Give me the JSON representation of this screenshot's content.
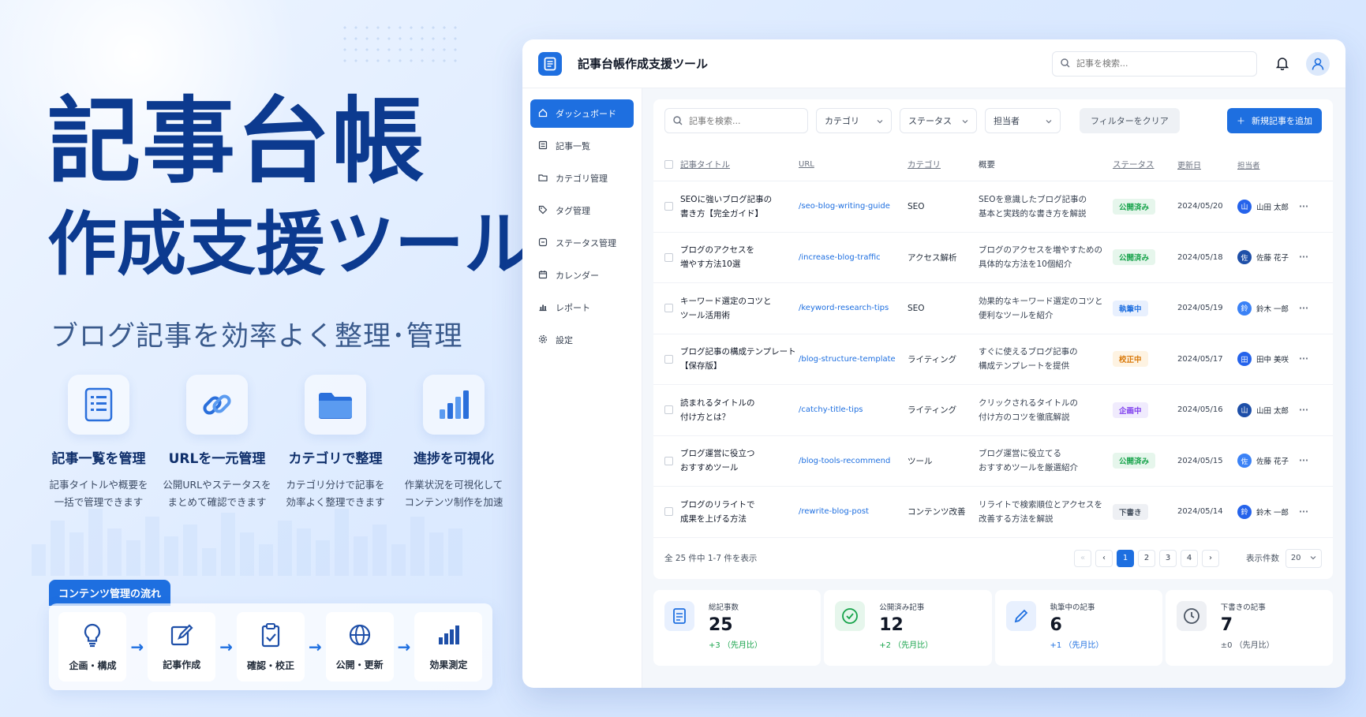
{
  "hero": {
    "title_line1": "記事台帳",
    "title_line2": "作成支援ツール",
    "subtitle": "ブログ記事を効率よく整理･管理"
  },
  "features": [
    {
      "icon": "document-icon",
      "title": "記事一覧を管理",
      "desc": "記事タイトルや概要を\n一括で管理できます"
    },
    {
      "icon": "link-icon",
      "title": "URLを一元管理",
      "desc": "公開URLやステータスを\nまとめて確認できます"
    },
    {
      "icon": "folder-icon",
      "title": "カテゴリで整理",
      "desc": "カテゴリ分けで記事を\n効率よく整理できます"
    },
    {
      "icon": "bar-chart-icon",
      "title": "進捗を可視化",
      "desc": "作業状況を可視化して\nコンテンツ制作を加速"
    }
  ],
  "flow": {
    "tag": "コンテンツ管理の流れ",
    "steps": [
      {
        "icon": "lightbulb-icon",
        "label": "企画・構成"
      },
      {
        "icon": "edit-icon",
        "label": "記事作成"
      },
      {
        "icon": "clipboard-check-icon",
        "label": "確認・校正"
      },
      {
        "icon": "globe-icon",
        "label": "公開・更新"
      },
      {
        "icon": "bar-chart-icon",
        "label": "効果測定"
      }
    ]
  },
  "app": {
    "title": "記事台帳作成支援ツール",
    "search_placeholder": "記事を検索...",
    "accent": "#1e6fe0"
  },
  "sidebar": {
    "items": [
      {
        "icon": "home-icon",
        "label": "ダッシュボード",
        "active": true
      },
      {
        "icon": "list-icon",
        "label": "記事一覧"
      },
      {
        "icon": "folder-icon",
        "label": "カテゴリ管理"
      },
      {
        "icon": "tag-icon",
        "label": "タグ管理"
      },
      {
        "icon": "status-icon",
        "label": "ステータス管理"
      },
      {
        "icon": "calendar-icon",
        "label": "カレンダー"
      },
      {
        "icon": "report-icon",
        "label": "レポート"
      },
      {
        "icon": "gear-icon",
        "label": "設定"
      }
    ]
  },
  "filters": {
    "search_placeholder": "記事を検索...",
    "category": "カテゴリ",
    "status": "ステータス",
    "assignee": "担当者",
    "clear": "フィルターをクリア",
    "add": "新規記事を追加"
  },
  "table": {
    "headers": {
      "title": "記事タイトル",
      "url": "URL",
      "category": "カテゴリ",
      "summary": "概要",
      "status": "ステータス",
      "date": "更新日",
      "assignee": "担当者"
    },
    "rows": [
      {
        "title": "SEOに強いブログ記事の\n書き方【完全ガイド】",
        "url": "/seo-blog-writing-guide",
        "category": "SEO",
        "summary": "SEOを意識したブログ記事の\n基本と実践的な書き方を解説",
        "status": "公開済み",
        "date": "2024/05/20",
        "avatar": "山",
        "user": "山田 太郎"
      },
      {
        "title": "ブログのアクセスを\n増やす方法10選",
        "url": "/increase-blog-traffic",
        "category": "アクセス解析",
        "summary": "ブログのアクセスを増やすための\n具体的な方法を10個紹介",
        "status": "公開済み",
        "date": "2024/05/18",
        "avatar": "佐",
        "user": "佐藤 花子"
      },
      {
        "title": "キーワード選定のコツと\nツール活用術",
        "url": "/keyword-research-tips",
        "category": "SEO",
        "summary": "効果的なキーワード選定のコツと\n便利なツールを紹介",
        "status": "執筆中",
        "date": "2024/05/19",
        "avatar": "鈴",
        "user": "鈴木 一郎"
      },
      {
        "title": "ブログ記事の構成テンプレート\n【保存版】",
        "url": "/blog-structure-template",
        "category": "ライティング",
        "summary": "すぐに使えるブログ記事の\n構成テンプレートを提供",
        "status": "校正中",
        "date": "2024/05/17",
        "avatar": "田",
        "user": "田中 美咲"
      },
      {
        "title": "読まれるタイトルの\n付け方とは？",
        "url": "/catchy-title-tips",
        "category": "ライティング",
        "summary": "クリックされるタイトルの\n付け方のコツを徹底解説",
        "status": "企画中",
        "date": "2024/05/16",
        "avatar": "山",
        "user": "山田 太郎"
      },
      {
        "title": "ブログ運営に役立つ\nおすすめツール",
        "url": "/blog-tools-recommend",
        "category": "ツール",
        "summary": "ブログ運営に役立てる\nおすすめツールを厳選紹介",
        "status": "公開済み",
        "date": "2024/05/15",
        "avatar": "佐",
        "user": "佐藤 花子"
      },
      {
        "title": "ブログのリライトで\n成果を上げる方法",
        "url": "/rewrite-blog-post",
        "category": "コンテンツ改善",
        "summary": "リライトで検索順位とアクセスを\n改善する方法を解説",
        "status": "下書き",
        "date": "2024/05/14",
        "avatar": "鈴",
        "user": "鈴木 一郎"
      }
    ]
  },
  "pagination": {
    "summary": "全 25 件中 1-7 件を表示",
    "pages": [
      "1",
      "2",
      "3",
      "4"
    ],
    "current": "1",
    "per_page_label": "表示件数",
    "per_page": "20"
  },
  "stats": [
    {
      "icon": "document-icon",
      "label": "総記事数",
      "value": "25",
      "change": "+3 （先月比）"
    },
    {
      "icon": "check-circle-icon",
      "label": "公開済み記事",
      "value": "12",
      "change": "+2 （先月比）"
    },
    {
      "icon": "pencil-icon",
      "label": "執筆中の記事",
      "value": "6",
      "change": "+1 （先月比）"
    },
    {
      "icon": "clock-icon",
      "label": "下書きの記事",
      "value": "7",
      "change": "±0 （先月比）"
    }
  ],
  "status_colors": {
    "公開済み": "#16a34a",
    "執筆中": "#1e6fe0",
    "校正中": "#d97706",
    "企画中": "#7c3aed",
    "下書き": "#4b5563"
  }
}
